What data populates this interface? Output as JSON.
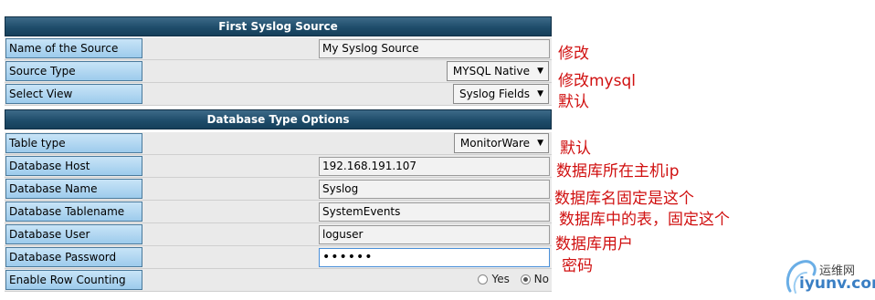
{
  "sections": {
    "first": {
      "title": "First Syslog Source"
    },
    "db": {
      "title": "Database Type Options"
    }
  },
  "first_rows": {
    "name": {
      "label": "Name of the Source",
      "value": "My Syslog Source",
      "note": "修改"
    },
    "type": {
      "label": "Source Type",
      "value": "MYSQL Native",
      "note": "修改mysql"
    },
    "view": {
      "label": "Select View",
      "value": "Syslog Fields",
      "note": "默认"
    }
  },
  "db_rows": {
    "table_type": {
      "label": "Table type",
      "value": "MonitorWare",
      "note": "默认"
    },
    "host": {
      "label": "Database Host",
      "value": "192.168.191.107",
      "note": "数据库所在主机ip"
    },
    "name": {
      "label": "Database Name",
      "value": "Syslog",
      "note": "数据库名固定是这个"
    },
    "tablename": {
      "label": "Database Tablename",
      "value": "SystemEvents",
      "note": "数据库中的表，固定这个"
    },
    "user": {
      "label": "Database User",
      "value": "loguser",
      "note": "数据库用户"
    },
    "password": {
      "label": "Database Password",
      "value": "••••••",
      "note": "密码"
    },
    "row_counting": {
      "label": "Enable Row Counting",
      "yes": "Yes",
      "no": "No",
      "selected": "No"
    }
  },
  "watermark": {
    "cn": "运维网",
    "en": "iyunv.com"
  },
  "icons": {
    "dropdown": "triangle-down-icon",
    "logo": "swirl-logo-icon"
  },
  "colors": {
    "header": "#1f4d6b",
    "label": "#9dcbec",
    "note": "#d01010"
  }
}
